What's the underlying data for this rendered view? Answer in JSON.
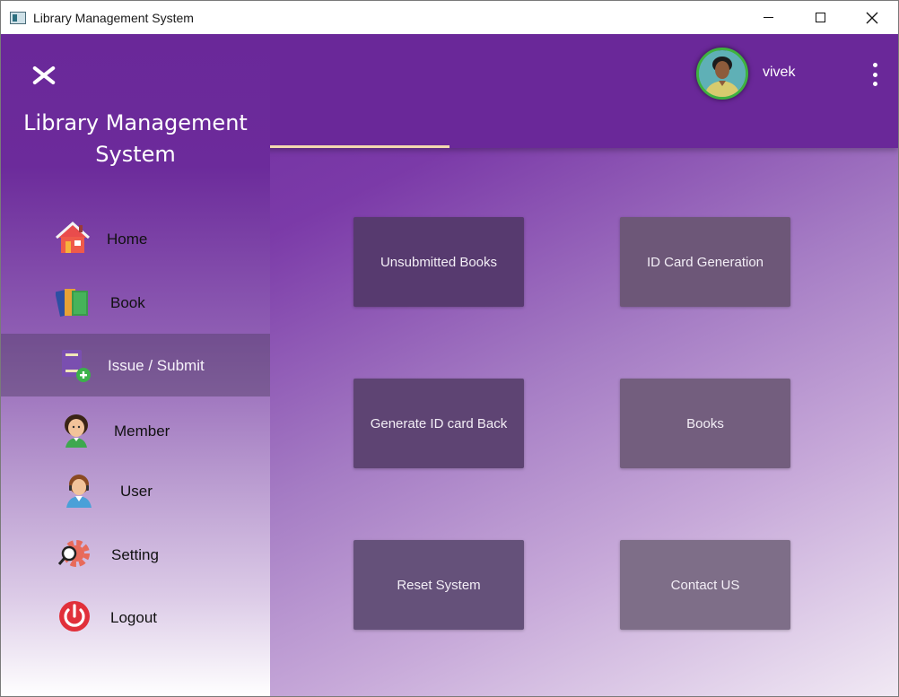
{
  "window": {
    "title": "Library Management System",
    "controls": {
      "minimize": "—",
      "maximize": "□",
      "close": "✕"
    }
  },
  "header": {
    "username": "vivek",
    "avatar_icon": "user-avatar",
    "menu_icon": "more-vert-icon"
  },
  "sidebar": {
    "title_line1": "Library Management",
    "title_line2": "System",
    "items": [
      {
        "label": "Home",
        "icon": "home-icon"
      },
      {
        "label": "Book",
        "icon": "book-icon"
      },
      {
        "label": "Issue / Submit",
        "icon": "issue-submit-icon",
        "active": true
      },
      {
        "label": "Member",
        "icon": "member-icon"
      },
      {
        "label": "User",
        "icon": "user-icon"
      },
      {
        "label": "Setting",
        "icon": "setting-icon"
      },
      {
        "label": "Logout",
        "icon": "logout-icon"
      }
    ]
  },
  "tiles": [
    {
      "label": "Unsubmitted Books"
    },
    {
      "label": "ID Card Generation"
    },
    {
      "label": "Generate ID card Back"
    },
    {
      "label": "Books"
    },
    {
      "label": "Reset System"
    },
    {
      "label": "Contact US"
    }
  ],
  "colors": {
    "primary": "#6a2899",
    "accent_underline": "#f3d9b0",
    "avatar_ring": "#3fb23f"
  }
}
